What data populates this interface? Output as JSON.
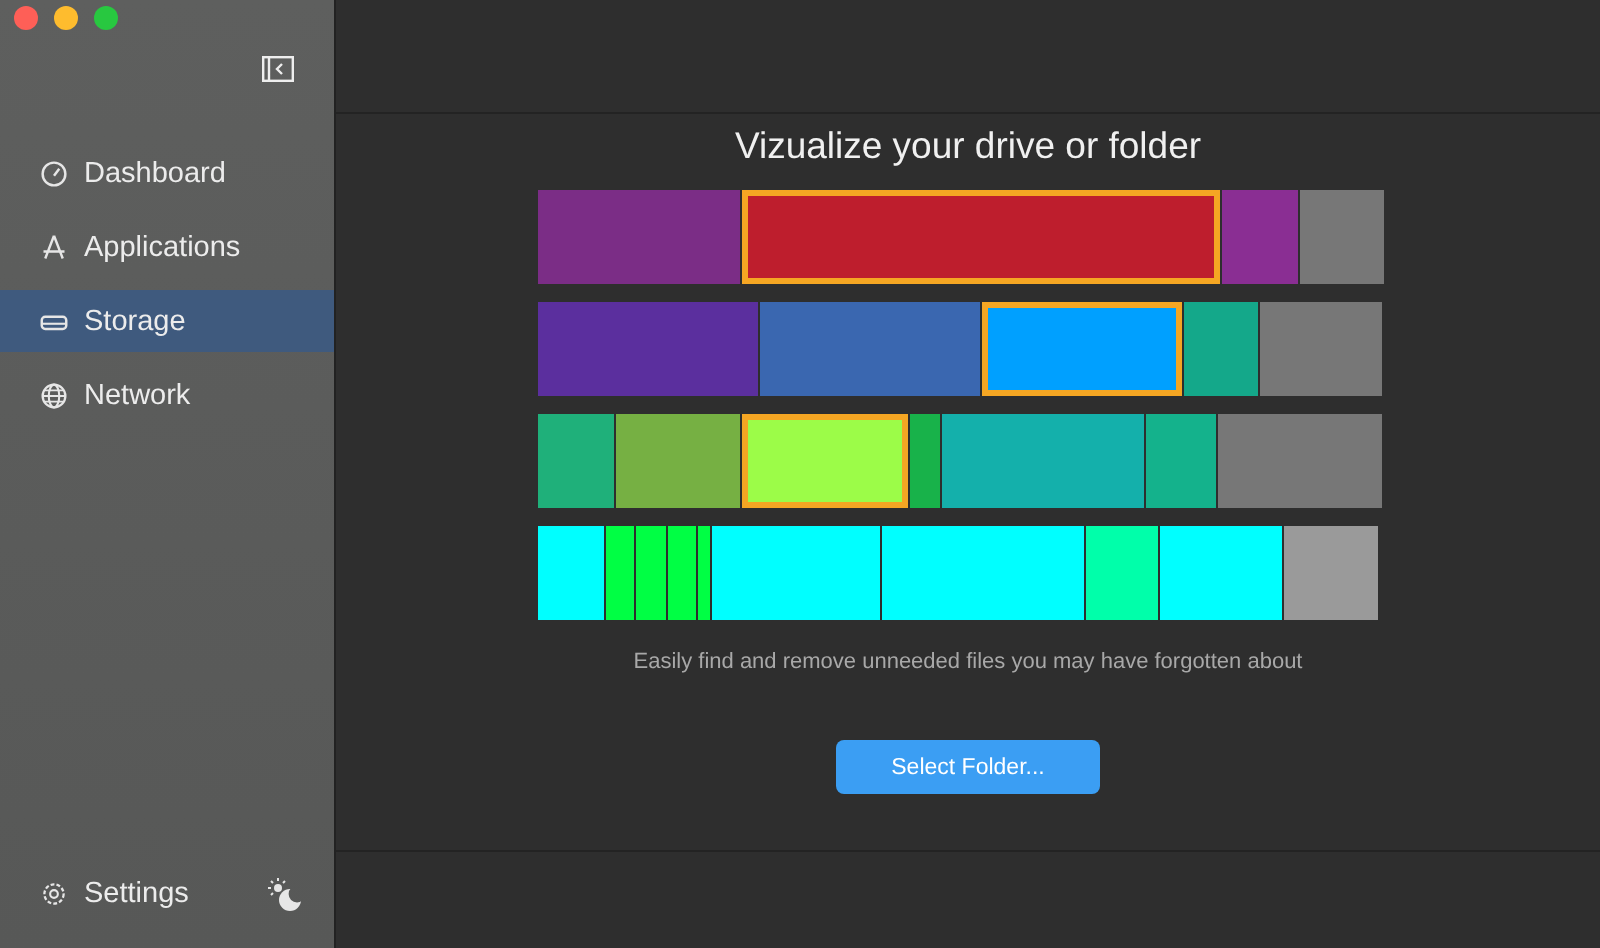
{
  "sidebar": {
    "items": [
      {
        "label": "Dashboard",
        "selected": false
      },
      {
        "label": "Applications",
        "selected": false
      },
      {
        "label": "Storage",
        "selected": true
      },
      {
        "label": "Network",
        "selected": false
      }
    ],
    "settings": "Settings"
  },
  "main": {
    "title": "Vizualize your drive or folder",
    "subtitle": "Easily find and remove unneeded files you may have forgotten about",
    "button": "Select Folder..."
  }
}
